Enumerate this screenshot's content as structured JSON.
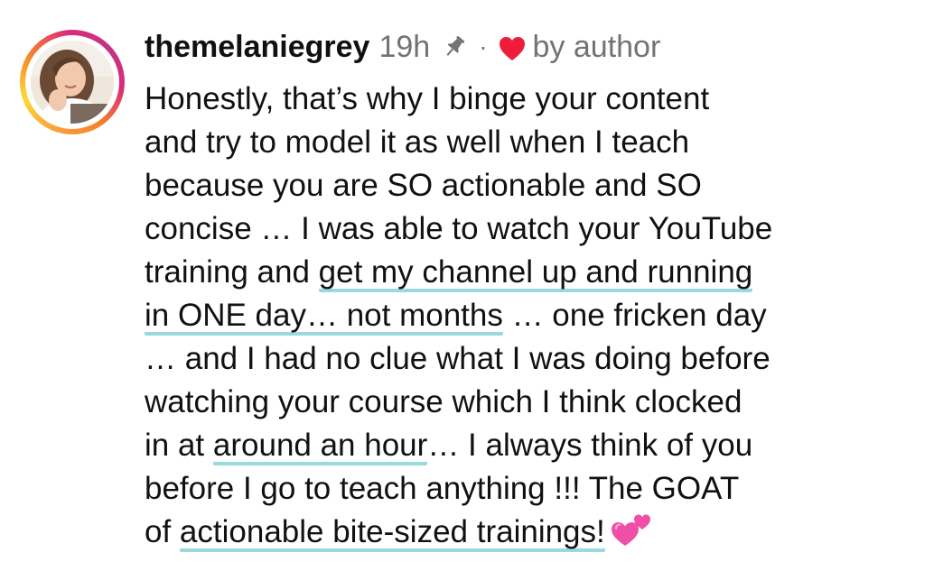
{
  "post": {
    "username": "themelaniegrey",
    "time": "19h",
    "separator": "·",
    "by_author": "by author",
    "icons": {
      "avatar": "profile-photo",
      "pin": "pin-icon",
      "heart": "heart-icon",
      "emoji": "two-hearts-emoji"
    },
    "colors": {
      "heart": "#ee1d3b",
      "underline": "#9ad9dc",
      "meta_gray": "#737373"
    }
  },
  "comment": {
    "l1": "Honestly, that’s why I binge your content",
    "l2": "and try to model it as well when I teach",
    "l3": "because you are SO actionable and SO",
    "l4": "concise … I was able to watch your YouTube",
    "l5a": "training and ",
    "l5b": "get my channel up and running",
    "l6a": "in ONE day… not months",
    "l6b": " … one fricken day",
    "l7": "… and I had no clue what I was doing before",
    "l8": "watching your course which I think clocked",
    "l9a": "in at ",
    "l9b": "around an hour",
    "l9c": "… I always think of you",
    "l10": "before I go to teach anything !!! The GOAT",
    "l11a": "of ",
    "l11b": "actionable bite-sized trainings!"
  }
}
